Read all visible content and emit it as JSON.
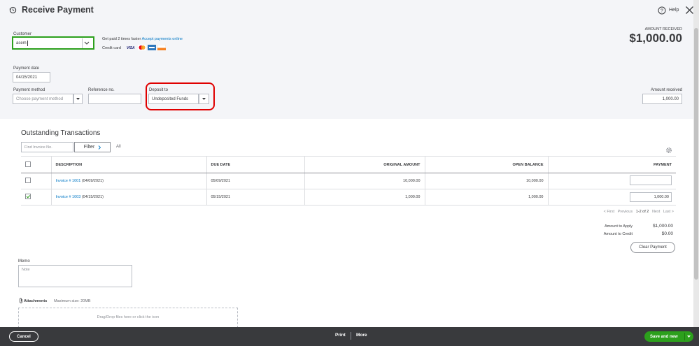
{
  "header": {
    "title": "Receive Payment",
    "help_label": "Help"
  },
  "customer": {
    "label": "Customer",
    "value": "asem",
    "promo_text": "Get paid 2 times faster",
    "promo_link": "Accept payments online",
    "credit_card_label": "Credit card",
    "visa_text": "VISA"
  },
  "amount_received_top": {
    "label": "AMOUNT RECEIVED",
    "value": "$1,000.00"
  },
  "payment_date": {
    "label": "Payment date",
    "value": "04/15/2021"
  },
  "payment_method": {
    "label": "Payment method",
    "placeholder": "Choose payment method"
  },
  "reference": {
    "label": "Reference no.",
    "value": ""
  },
  "deposit_to": {
    "label": "Deposit to",
    "value": "Undeposited Funds"
  },
  "amount_received_field": {
    "label": "Amount received",
    "value": "1,000.00"
  },
  "outstanding": {
    "title": "Outstanding Transactions",
    "find_placeholder": "Find Invoice No.",
    "filter_label": "Filter",
    "all_label": "All",
    "columns": [
      "DESCRIPTION",
      "DUE DATE",
      "ORIGINAL AMOUNT",
      "OPEN BALANCE",
      "PAYMENT"
    ],
    "rows": [
      {
        "checked": false,
        "invoice": "Invoice # 1001",
        "date": "(04/09/2021)",
        "due_date": "05/09/2021",
        "original_amount": "10,000.00",
        "open_balance": "10,000.00",
        "payment": ""
      },
      {
        "checked": true,
        "invoice": "Invoice # 1003",
        "date": "(04/15/2021)",
        "due_date": "05/15/2021",
        "original_amount": "1,000.00",
        "open_balance": "1,000.00",
        "payment": "1,000.00"
      }
    ],
    "pagination": {
      "first": "< First",
      "previous": "Previous",
      "range": "1-2 of 2",
      "next": "Next",
      "last": "Last >"
    }
  },
  "totals": {
    "amount_to_apply_label": "Amount to Apply",
    "amount_to_apply": "$1,000.00",
    "amount_to_credit_label": "Amount to Credit",
    "amount_to_credit": "$0.00",
    "clear_payment_label": "Clear Payment"
  },
  "memo": {
    "label": "Memo",
    "placeholder": "Note"
  },
  "attachments": {
    "label": "Attachments",
    "max_size": "Maximum size: 20MB",
    "dropzone_text": "Drag/Drop files here or click the icon"
  },
  "footer": {
    "cancel_label": "Cancel",
    "print_label": "Print",
    "more_label": "More",
    "save_label": "Save and new"
  },
  "colors": {
    "accent_green": "#2ca01c",
    "link_blue": "#0077c5",
    "highlight_red": "#e00000",
    "footer_bg": "#393a3d"
  }
}
